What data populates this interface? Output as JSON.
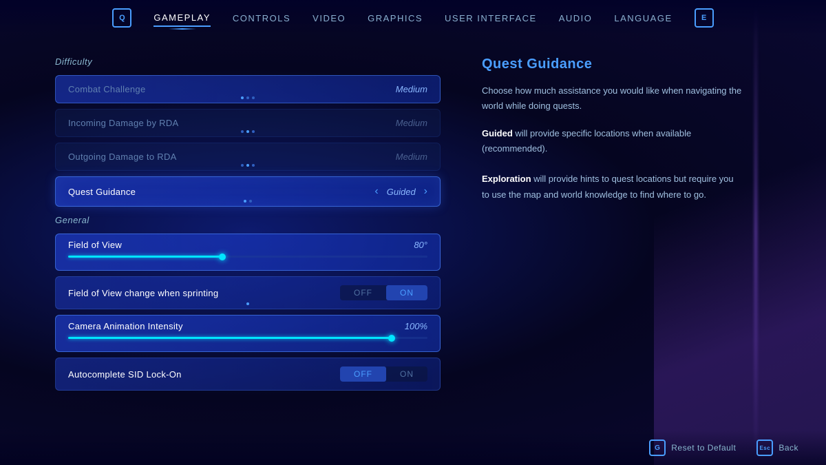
{
  "nav": {
    "left_icon": "Q",
    "right_icon": "E",
    "tabs": [
      {
        "label": "GAMEPLAY",
        "active": true
      },
      {
        "label": "CONTROLS",
        "active": false
      },
      {
        "label": "VIDEO",
        "active": false
      },
      {
        "label": "GRAPHICS",
        "active": false
      },
      {
        "label": "USER INTERFACE",
        "active": false
      },
      {
        "label": "AUDIO",
        "active": false
      },
      {
        "label": "LANGUAGE",
        "active": false
      }
    ]
  },
  "left": {
    "section_difficulty": "Difficulty",
    "section_general": "General",
    "settings": [
      {
        "id": "combat-challenge",
        "name": "Combat Challenge",
        "value": "Medium",
        "type": "selector",
        "active": false,
        "dots": [
          true,
          false,
          false
        ],
        "inactive": false
      },
      {
        "id": "incoming-damage",
        "name": "Incoming Damage by RDA",
        "value": "Medium",
        "type": "selector",
        "active": false,
        "dots": [
          false,
          true,
          false
        ],
        "inactive": true
      },
      {
        "id": "outgoing-damage",
        "name": "Outgoing Damage to RDA",
        "value": "Medium",
        "type": "selector",
        "active": false,
        "dots": [
          false,
          true,
          false
        ],
        "inactive": true
      },
      {
        "id": "quest-guidance",
        "name": "Quest Guidance",
        "value": "Guided",
        "type": "selector-nav",
        "active": true,
        "dots": [
          true,
          false
        ],
        "inactive": false
      }
    ],
    "general_settings": [
      {
        "id": "fov",
        "name": "Field of View",
        "value": "80°",
        "type": "slider",
        "fill_pct": 43
      },
      {
        "id": "fov-sprint",
        "name": "Field of View change when sprinting",
        "value": "",
        "type": "toggle",
        "off_label": "OFF",
        "on_label": "ON",
        "selected": "ON"
      },
      {
        "id": "cam-anim",
        "name": "Camera Animation Intensity",
        "value": "100%",
        "type": "slider",
        "fill_pct": 90
      },
      {
        "id": "autocomplete",
        "name": "Autocomplete SID Lock-On",
        "value": "",
        "type": "toggle",
        "off_label": "OFF",
        "on_label": "ON",
        "selected": "OFF"
      }
    ]
  },
  "right": {
    "title": "Quest Guidance",
    "paragraph1": "Choose how much assistance you would like when navigating the world while doing quests.",
    "guided_label": "Guided",
    "guided_desc": " will provide specific locations when available (recommended).",
    "exploration_label": "Exploration",
    "exploration_desc": " will provide hints to quest locations but require you to use the map and world knowledge to find where to go."
  },
  "bottom": {
    "reset_icon": "G",
    "reset_label": "Reset to Default",
    "back_icon": "Esc",
    "back_label": "Back"
  }
}
